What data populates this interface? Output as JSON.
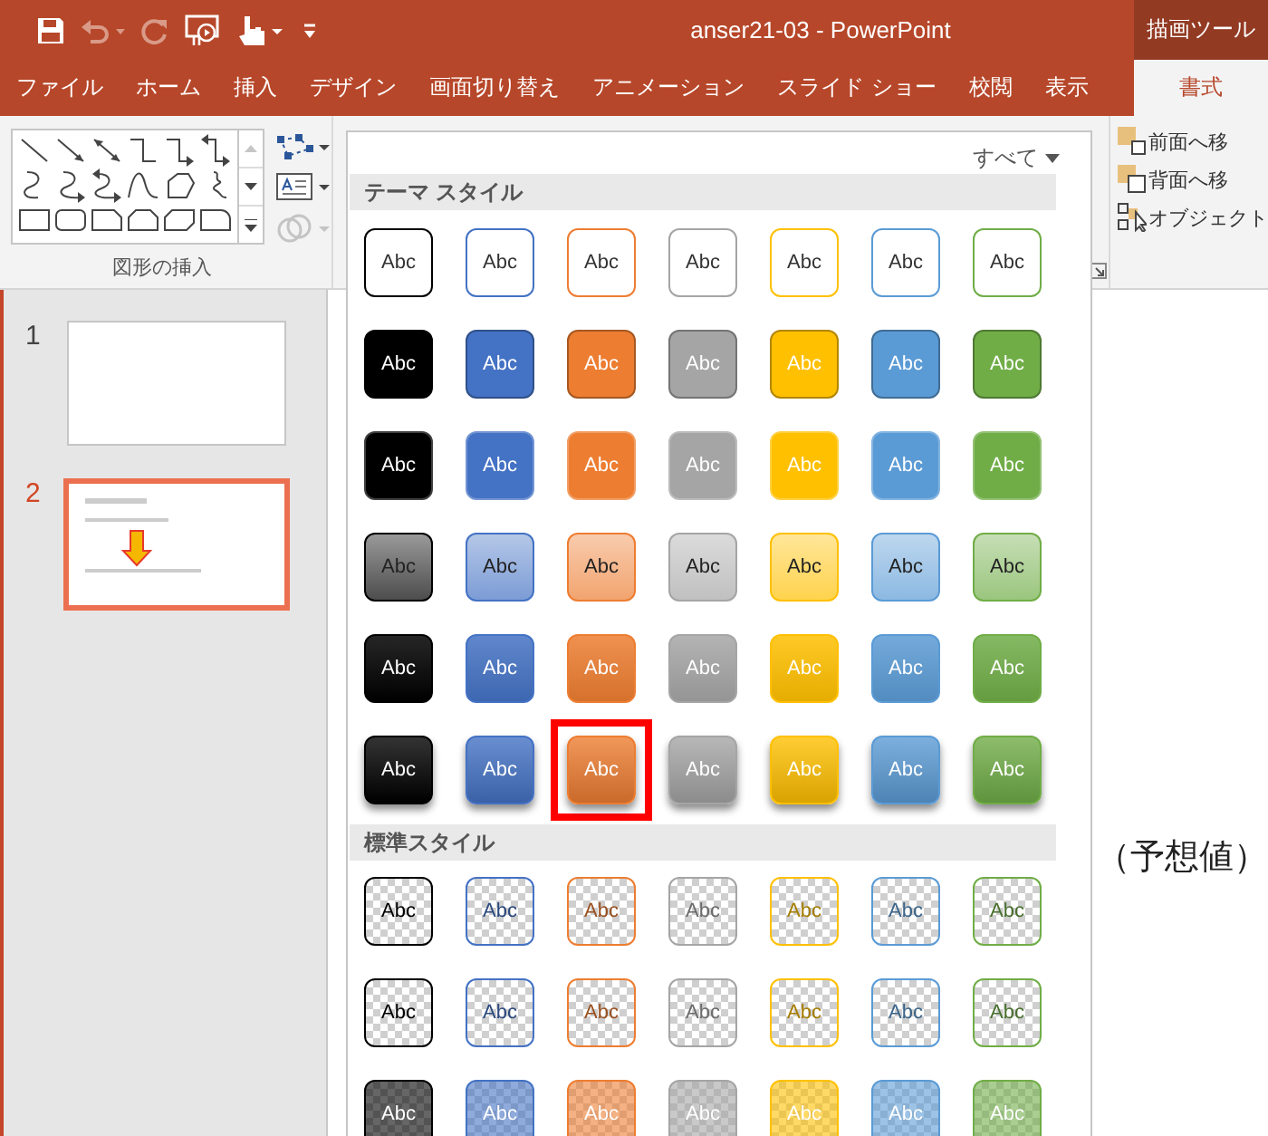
{
  "window": {
    "title": "anser21-03 - PowerPoint",
    "context_group": "描画ツール"
  },
  "quick_access": [
    {
      "kind": "save",
      "disabled": false
    },
    {
      "kind": "undo",
      "disabled": true
    },
    {
      "kind": "redo",
      "disabled": true
    },
    {
      "kind": "present",
      "disabled": false
    },
    {
      "kind": "touch",
      "disabled": false
    },
    {
      "kind": "customize",
      "disabled": false
    }
  ],
  "tabs": [
    {
      "label": "ファイル",
      "selected": false
    },
    {
      "label": "ホーム",
      "selected": false
    },
    {
      "label": "挿入",
      "selected": false
    },
    {
      "label": "デザイン",
      "selected": false
    },
    {
      "label": "画面切り替え",
      "selected": false
    },
    {
      "label": "アニメーション",
      "selected": false
    },
    {
      "label": "スライド ショー",
      "selected": false
    },
    {
      "label": "校閲",
      "selected": false
    },
    {
      "label": "表示",
      "selected": false
    },
    {
      "label": "書式",
      "selected": true
    }
  ],
  "ribbon": {
    "insert_shapes": {
      "label": "図形の挿入",
      "tools": [
        {
          "kind": "edit-shape",
          "disabled": false
        },
        {
          "kind": "text-box",
          "disabled": false
        },
        {
          "kind": "merge-shapes",
          "disabled": true
        }
      ]
    },
    "arrange": [
      {
        "label": "前面へ移"
      },
      {
        "label": "背面へ移"
      },
      {
        "label": "オブジェクト"
      }
    ]
  },
  "slides": [
    {
      "number": "1",
      "kind": "blank",
      "selected": false
    },
    {
      "number": "2",
      "kind": "content",
      "selected": true
    }
  ],
  "slide": {
    "text": "（予想値）"
  },
  "gallery": {
    "filter": "すべて",
    "sections": [
      {
        "title": "テーマ スタイル",
        "rows": [
          {
            "kind": "outline",
            "items": [
              {
                "label": "Abc",
                "color": "#000000",
                "selected": false
              },
              {
                "label": "Abc",
                "color": "#4472c4",
                "selected": false
              },
              {
                "label": "Abc",
                "color": "#ed7d31",
                "selected": false
              },
              {
                "label": "Abc",
                "color": "#a5a5a5",
                "selected": false
              },
              {
                "label": "Abc",
                "color": "#ffc000",
                "selected": false
              },
              {
                "label": "Abc",
                "color": "#5b9bd5",
                "selected": false
              },
              {
                "label": "Abc",
                "color": "#70ad47",
                "selected": false
              }
            ]
          },
          {
            "kind": "fill",
            "items": [
              {
                "label": "Abc",
                "color": "#000000",
                "selected": false
              },
              {
                "label": "Abc",
                "color": "#4472c4",
                "selected": false
              },
              {
                "label": "Abc",
                "color": "#ed7d31",
                "selected": false
              },
              {
                "label": "Abc",
                "color": "#a5a5a5",
                "selected": false
              },
              {
                "label": "Abc",
                "color": "#ffc000",
                "selected": false
              },
              {
                "label": "Abc",
                "color": "#5b9bd5",
                "selected": false
              },
              {
                "label": "Abc",
                "color": "#70ad47",
                "selected": false
              }
            ]
          },
          {
            "kind": "light-fill",
            "items": [
              {
                "label": "Abc",
                "color": "#000000",
                "selected": false
              },
              {
                "label": "Abc",
                "color": "#4472c4",
                "selected": false
              },
              {
                "label": "Abc",
                "color": "#ed7d31",
                "selected": false
              },
              {
                "label": "Abc",
                "color": "#a5a5a5",
                "selected": false
              },
              {
                "label": "Abc",
                "color": "#ffc000",
                "selected": false
              },
              {
                "label": "Abc",
                "color": "#5b9bd5",
                "selected": false
              },
              {
                "label": "Abc",
                "color": "#70ad47",
                "selected": false
              }
            ]
          },
          {
            "kind": "gradient-light",
            "items": [
              {
                "label": "Abc",
                "color": "#000000",
                "selected": false
              },
              {
                "label": "Abc",
                "color": "#4472c4",
                "selected": false
              },
              {
                "label": "Abc",
                "color": "#ed7d31",
                "selected": false
              },
              {
                "label": "Abc",
                "color": "#a5a5a5",
                "selected": false
              },
              {
                "label": "Abc",
                "color": "#ffc000",
                "selected": false
              },
              {
                "label": "Abc",
                "color": "#5b9bd5",
                "selected": false
              },
              {
                "label": "Abc",
                "color": "#70ad47",
                "selected": false
              }
            ]
          },
          {
            "kind": "gradient",
            "items": [
              {
                "label": "Abc",
                "color": "#000000",
                "selected": false
              },
              {
                "label": "Abc",
                "color": "#4472c4",
                "selected": false
              },
              {
                "label": "Abc",
                "color": "#ed7d31",
                "selected": false
              },
              {
                "label": "Abc",
                "color": "#a5a5a5",
                "selected": false
              },
              {
                "label": "Abc",
                "color": "#ffc000",
                "selected": false
              },
              {
                "label": "Abc",
                "color": "#5b9bd5",
                "selected": false
              },
              {
                "label": "Abc",
                "color": "#70ad47",
                "selected": false
              }
            ]
          },
          {
            "kind": "intense",
            "items": [
              {
                "label": "Abc",
                "color": "#000000",
                "selected": false
              },
              {
                "label": "Abc",
                "color": "#4472c4",
                "selected": false
              },
              {
                "label": "Abc",
                "color": "#ed7d31",
                "selected": true
              },
              {
                "label": "Abc",
                "color": "#a5a5a5",
                "selected": false
              },
              {
                "label": "Abc",
                "color": "#ffc000",
                "selected": false
              },
              {
                "label": "Abc",
                "color": "#5b9bd5",
                "selected": false
              },
              {
                "label": "Abc",
                "color": "#70ad47",
                "selected": false
              }
            ]
          }
        ]
      },
      {
        "title": "標準スタイル",
        "rows": [
          {
            "kind": "clear",
            "items": [
              {
                "label": "Abc",
                "color": "#000000",
                "selected": false
              },
              {
                "label": "Abc",
                "color": "#4472c4",
                "selected": false
              },
              {
                "label": "Abc",
                "color": "#ed7d31",
                "selected": false
              },
              {
                "label": "Abc",
                "color": "#a5a5a5",
                "selected": false
              },
              {
                "label": "Abc",
                "color": "#ffc000",
                "selected": false
              },
              {
                "label": "Abc",
                "color": "#5b9bd5",
                "selected": false
              },
              {
                "label": "Abc",
                "color": "#70ad47",
                "selected": false
              }
            ]
          },
          {
            "kind": "clear-outline",
            "items": [
              {
                "label": "Abc",
                "color": "#000000",
                "selected": false
              },
              {
                "label": "Abc",
                "color": "#4472c4",
                "selected": false
              },
              {
                "label": "Abc",
                "color": "#ed7d31",
                "selected": false
              },
              {
                "label": "Abc",
                "color": "#a5a5a5",
                "selected": false
              },
              {
                "label": "Abc",
                "color": "#ffc000",
                "selected": false
              },
              {
                "label": "Abc",
                "color": "#5b9bd5",
                "selected": false
              },
              {
                "label": "Abc",
                "color": "#70ad47",
                "selected": false
              }
            ]
          },
          {
            "kind": "clear-fill",
            "items": [
              {
                "label": "Abc",
                "color": "#000000",
                "selected": false
              },
              {
                "label": "Abc",
                "color": "#4472c4",
                "selected": false
              },
              {
                "label": "Abc",
                "color": "#ed7d31",
                "selected": false
              },
              {
                "label": "Abc",
                "color": "#a5a5a5",
                "selected": false
              },
              {
                "label": "Abc",
                "color": "#ffc000",
                "selected": false
              },
              {
                "label": "Abc",
                "color": "#5b9bd5",
                "selected": false
              },
              {
                "label": "Abc",
                "color": "#70ad47",
                "selected": false
              }
            ]
          }
        ]
      }
    ]
  }
}
